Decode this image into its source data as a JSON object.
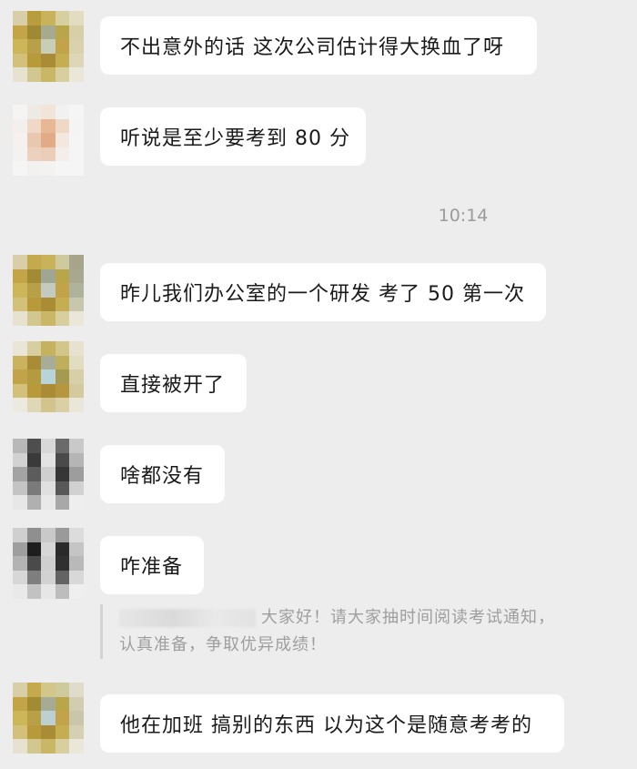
{
  "chat": {
    "timestamp": "10:14",
    "messages": [
      {
        "text": "不出意外的话  这次公司估计得大换血了呀"
      },
      {
        "text": "听说是至少要考到 80 分"
      },
      {
        "text": "昨儿我们办公室的一个研发 考了 50 第一次"
      },
      {
        "text": "直接被开了"
      },
      {
        "text": "啥都没有"
      },
      {
        "text": "咋准备"
      },
      {
        "text": "他在加班 搞别的东西  以为这个是随意考考的"
      }
    ],
    "quoted_message": {
      "line1": "大家好！请大家抽时间阅读考试通知，",
      "line2": "认真准备，争取优异成绩！"
    }
  }
}
